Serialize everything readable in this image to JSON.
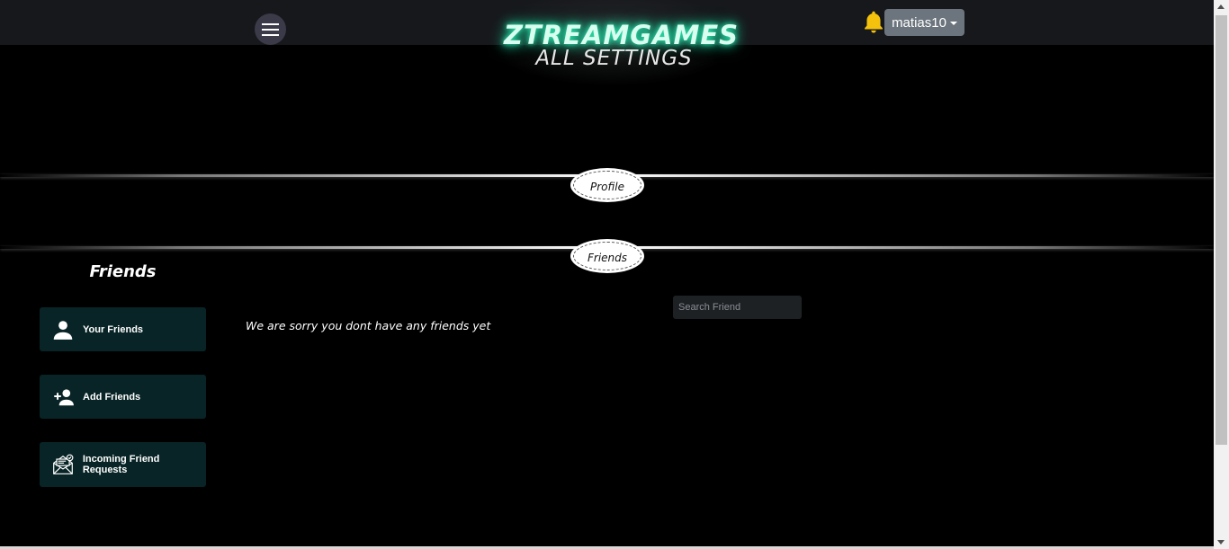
{
  "header": {
    "brand": "ZTREAMGAMES",
    "subtitle": "ALL SETTINGS",
    "menu_icon": "hamburger-icon",
    "notification_icon": "bell-icon",
    "user_name": "matias10"
  },
  "sections": {
    "profile_label": "Profile",
    "friends_label": "Friends"
  },
  "friends": {
    "heading": "Friends",
    "menu": [
      {
        "label": "Your Friends",
        "icon": "person-icon"
      },
      {
        "label": "Add Friends",
        "icon": "person-add-icon"
      },
      {
        "label": "Incoming Friend Requests",
        "icon": "envelope-icon"
      }
    ],
    "empty_message": "We are sorry you dont have any friends yet",
    "search_placeholder": "Search Friend"
  },
  "colors": {
    "background": "#000000",
    "navbar": "#17181c",
    "brand_glow": "#1bd79e",
    "bell": "#f4c20d",
    "user_button": "#6c757d",
    "side_button": "#082426",
    "search_bg": "#1e2124"
  }
}
